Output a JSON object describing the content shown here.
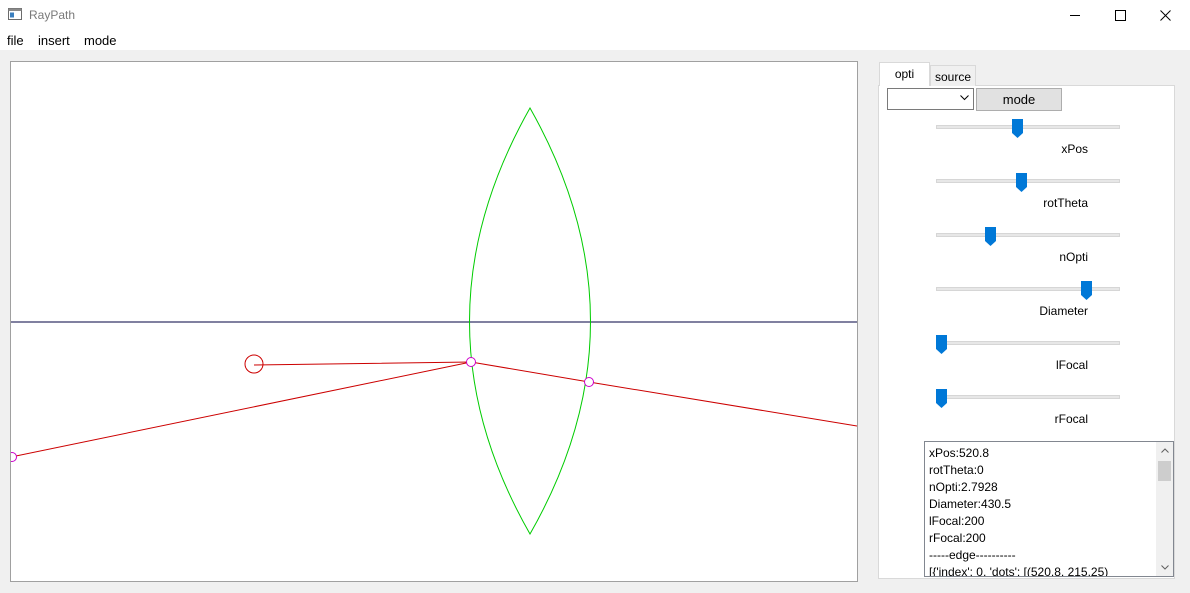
{
  "window": {
    "title": "RayPath",
    "icon": "app-window-icon"
  },
  "menu": {
    "items": [
      "file",
      "insert",
      "mode"
    ]
  },
  "tabs": [
    {
      "label": "opti",
      "active": true
    },
    {
      "label": "source",
      "active": false
    }
  ],
  "controls": {
    "combo_value": "",
    "mode_button": "mode"
  },
  "sliders": [
    {
      "label": "xPos",
      "fraction": 0.44
    },
    {
      "label": "rotTheta",
      "fraction": 0.465
    },
    {
      "label": "nOpti",
      "fraction": 0.285
    },
    {
      "label": "Diameter",
      "fraction": 0.84
    },
    {
      "label": "lFocal",
      "fraction": 0.0
    },
    {
      "label": "rFocal",
      "fraction": 0.0
    }
  ],
  "info_lines": [
    "xPos:520.8",
    "rotTheta:0",
    "nOpti:2.7928",
    "Diameter:430.5",
    "lFocal:200",
    "rFocal:200",
    "-----edge----------",
    "[{'index': 0, 'dots': [(520.8, 215.25)"
  ],
  "colors": {
    "lens": "#00cc00",
    "ray": "#cc0000",
    "axis": "#000040",
    "dot": "#cc00cc",
    "slider_accent": "#0078d7"
  }
}
